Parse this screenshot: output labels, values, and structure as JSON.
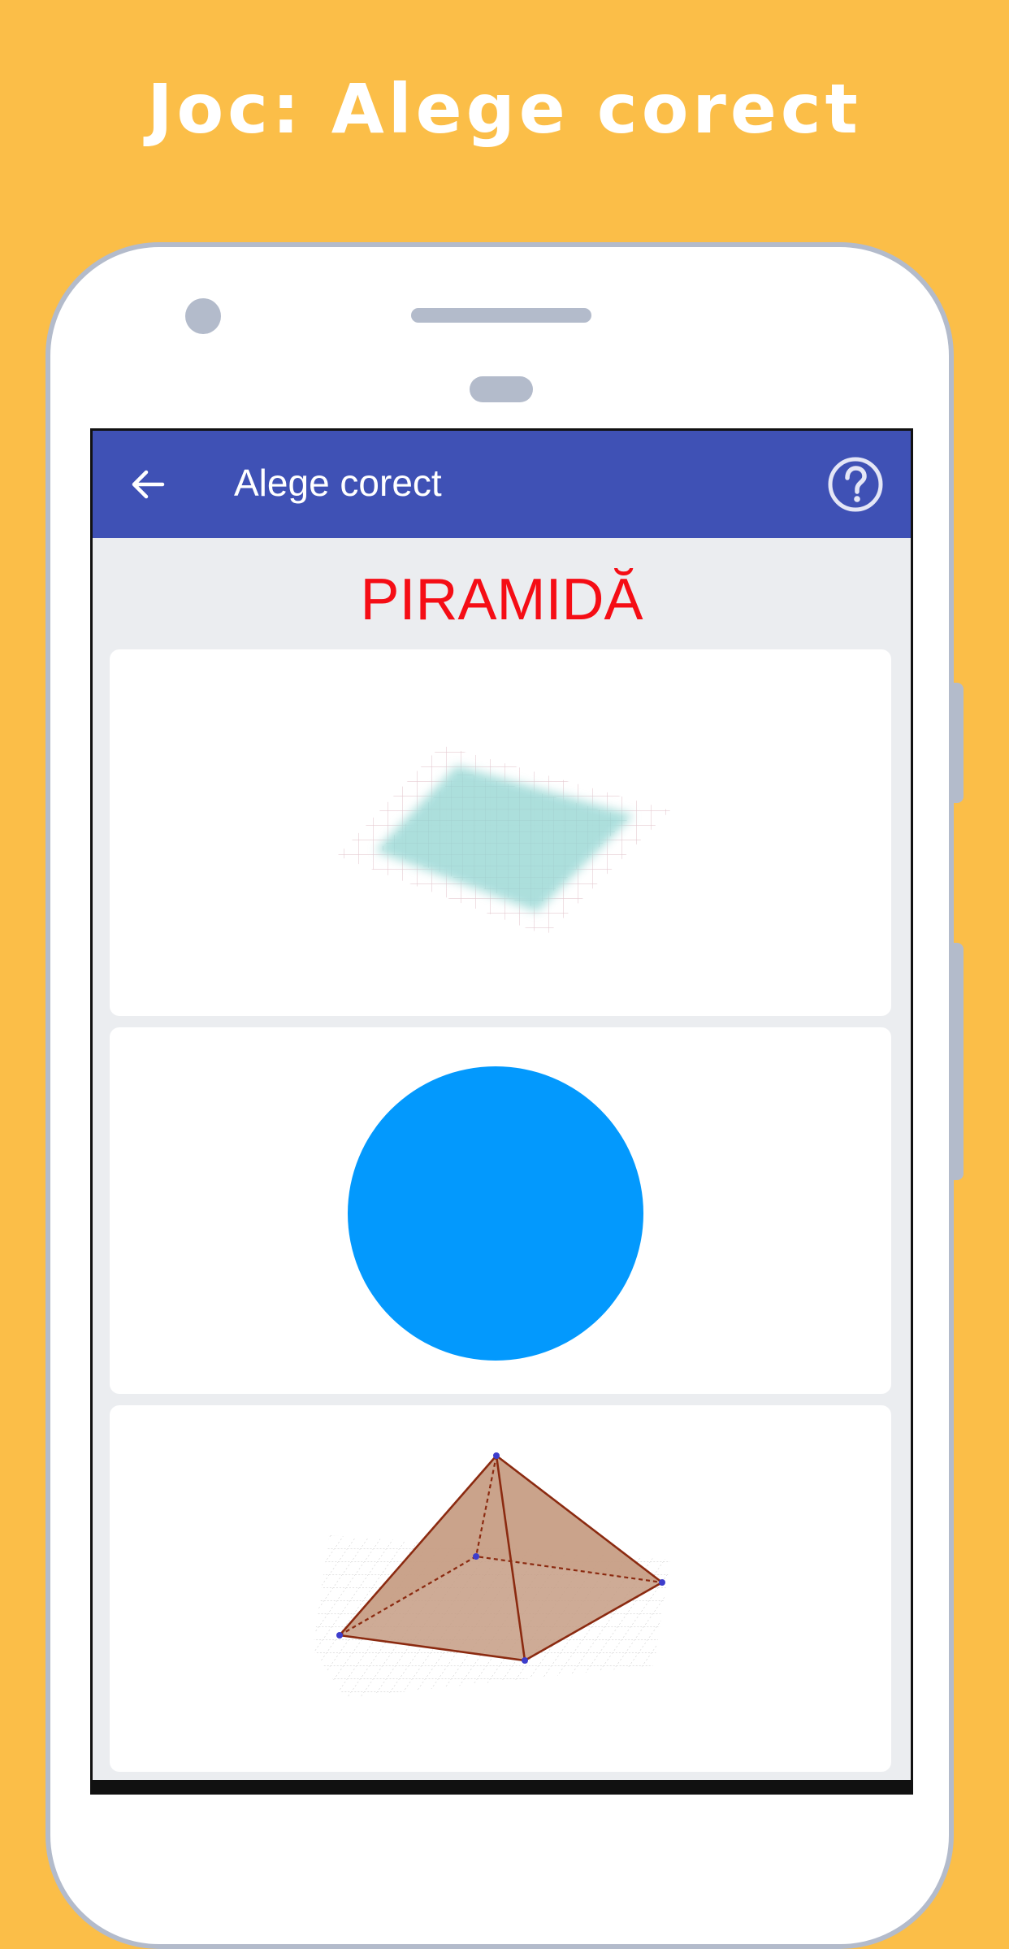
{
  "promo": {
    "title": "Joc: Alege corect"
  },
  "appbar": {
    "title": "Alege corect",
    "back_icon": "arrow-left-icon",
    "help_icon": "help-circle-icon"
  },
  "question": {
    "word": "PIRAMIDĂ",
    "color": "#F50D15"
  },
  "options": [
    {
      "shape": "square-plane",
      "fill": "#A8DEDB"
    },
    {
      "shape": "circle",
      "fill": "#0399FD"
    },
    {
      "shape": "pyramid",
      "fill": "#C69C84"
    }
  ],
  "colors": {
    "background": "#FBBE48",
    "phone_frame": "#B3BBCB",
    "appbar": "#3F51B5",
    "screen_bg": "#EBEDF0"
  }
}
